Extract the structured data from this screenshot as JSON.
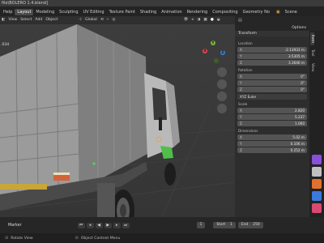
{
  "window": {
    "title": "file\\BOLERO 1.4.blend]"
  },
  "topbar": {
    "tabs": [
      {
        "label": "Help"
      },
      {
        "label": "Layout"
      },
      {
        "label": "Modeling"
      },
      {
        "label": "Sculpting"
      },
      {
        "label": "UV Editing"
      },
      {
        "label": "Texture Paint"
      },
      {
        "label": "Shading"
      },
      {
        "label": "Animation"
      },
      {
        "label": "Rendering"
      },
      {
        "label": "Compositing"
      },
      {
        "label": "Geometry No"
      }
    ],
    "scene_label": "Scene"
  },
  "viewport_header": {
    "menus": [
      "View",
      "Select",
      "Add",
      "Object"
    ],
    "orientation": "Global",
    "options_label": "Options",
    "object_label": ".034"
  },
  "properties": {
    "transform_title": "Transform",
    "location_label": "Location",
    "location": [
      {
        "axis": "X",
        "value": "-2.13933 m"
      },
      {
        "axis": "Y",
        "value": "3.5305 m"
      },
      {
        "axis": "Z",
        "value": "3.3646 m"
      }
    ],
    "rotation_label": "Rotation",
    "rotation": [
      {
        "axis": "X",
        "value": "0°"
      },
      {
        "axis": "Y",
        "value": "0°"
      },
      {
        "axis": "Z",
        "value": "0°"
      }
    ],
    "rotation_mode": "XYZ Euler",
    "scale_label": "Scale",
    "scale": [
      {
        "axis": "X",
        "value": "2.820"
      },
      {
        "axis": "Y",
        "value": "5.237"
      },
      {
        "axis": "Z",
        "value": "1.060"
      }
    ],
    "dimensions_label": "Dimensions",
    "dimensions": [
      {
        "axis": "X",
        "value": "5.02 m"
      },
      {
        "axis": "Y",
        "value": "0.106 m"
      },
      {
        "axis": "Z",
        "value": "0.252 m"
      }
    ],
    "side_tabs": [
      "Item",
      "Tool",
      "View"
    ]
  },
  "gizmo": {
    "x": "X",
    "y": "Y",
    "z": "Z"
  },
  "timeline": {
    "marker_label": "Marker",
    "current_frame": "1",
    "start_label": "Start",
    "start_value": "1",
    "end_label": "End",
    "end_value": "250"
  },
  "statusbar": {
    "left_hint": "Rotate View",
    "mid_hint": "Object Context Menu"
  },
  "colors": {
    "accent": "#4772b3",
    "x_axis": "#e0484f",
    "y_axis": "#79b33a",
    "z_axis": "#3b7ad8"
  }
}
